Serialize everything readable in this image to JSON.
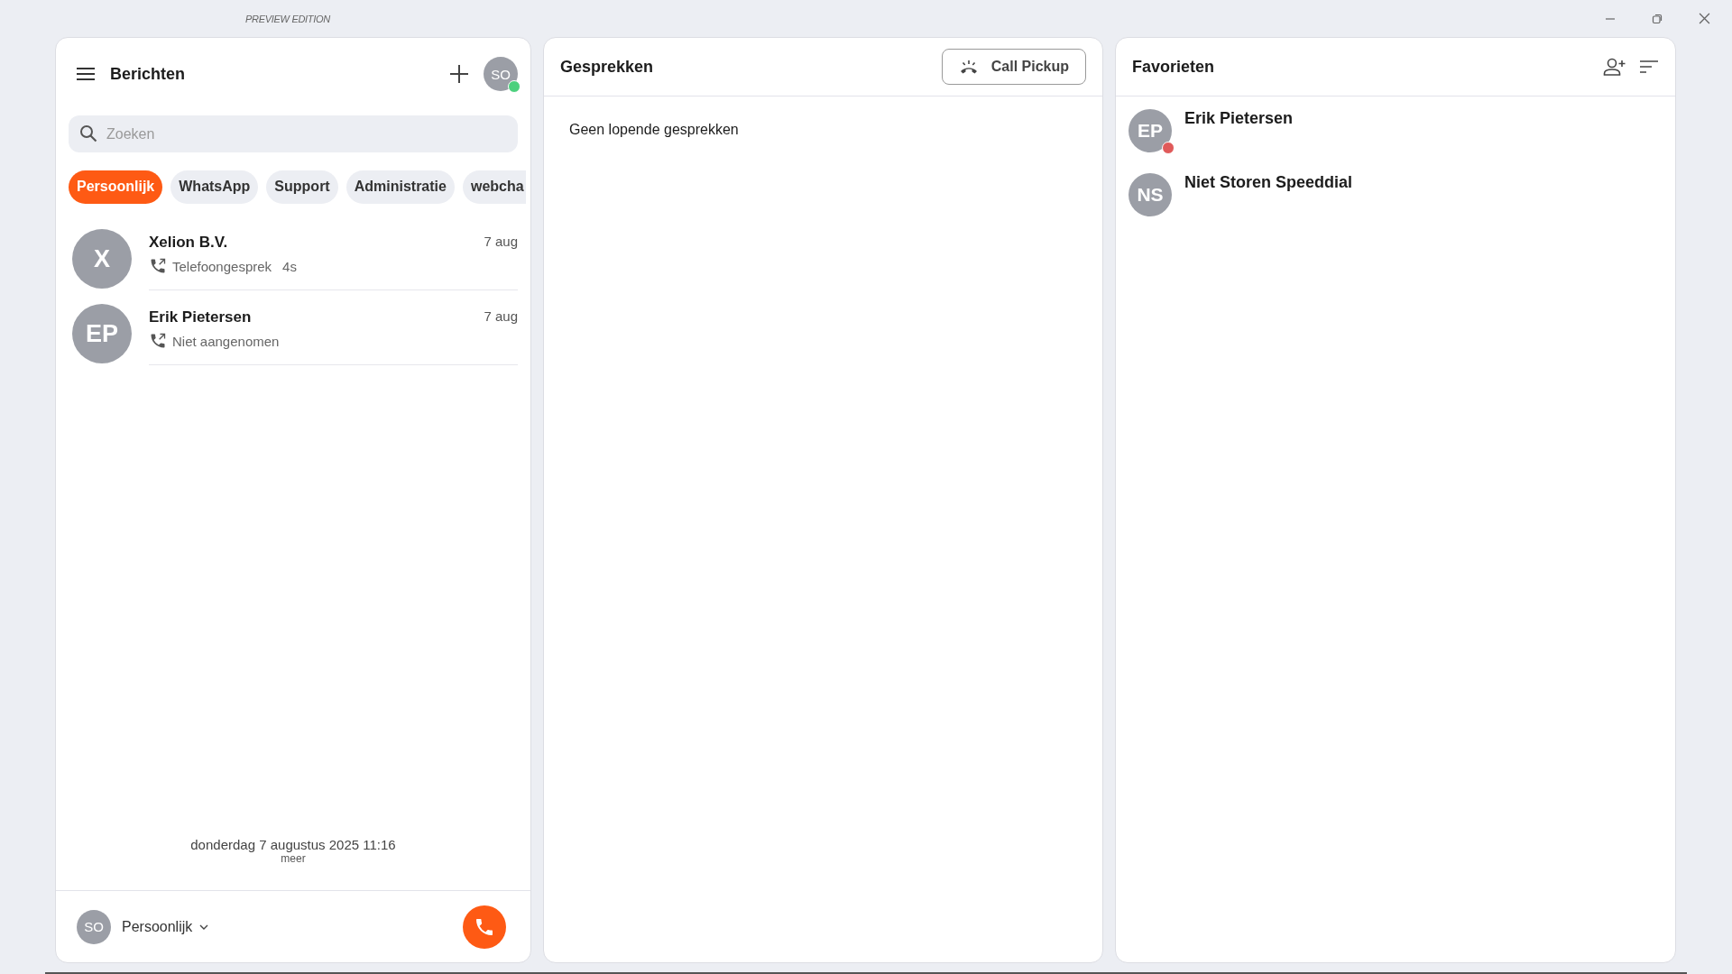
{
  "window": {
    "edition": "PREVIEW EDITION"
  },
  "messages": {
    "title": "Berichten",
    "user": {
      "initials": "SO",
      "color": "#4cd07d"
    },
    "search": {
      "placeholder": "Zoeken"
    },
    "filters": [
      {
        "label": "Persoonlijk",
        "selected": true
      },
      {
        "label": "WhatsApp",
        "selected": false
      },
      {
        "label": "Support",
        "selected": false
      },
      {
        "label": "Administratie",
        "selected": false
      },
      {
        "label": "webcha",
        "selected": false
      }
    ],
    "conversations": [
      {
        "initials": "X",
        "name": "Xelion B.V.",
        "date": "7 aug",
        "detail": "Telefoongesprek",
        "duration": "4s"
      },
      {
        "initials": "EP",
        "name": "Erik Pietersen",
        "date": "7 aug",
        "detail": "Niet aangenomen"
      }
    ],
    "timestamp": "donderdag 7 augustus 2025 11:16",
    "more": "meer",
    "footer": {
      "initials": "SO",
      "account": "Persoonlijk"
    }
  },
  "calls": {
    "title": "Gesprekken",
    "pickup_button": "Call Pickup",
    "empty": "Geen lopende gesprekken"
  },
  "favorites": {
    "title": "Favorieten",
    "items": [
      {
        "initials": "EP",
        "name": "Erik Pietersen",
        "color": "#e05a5a"
      },
      {
        "initials": "NS",
        "name": "Niet Storen Speeddial"
      }
    ]
  }
}
